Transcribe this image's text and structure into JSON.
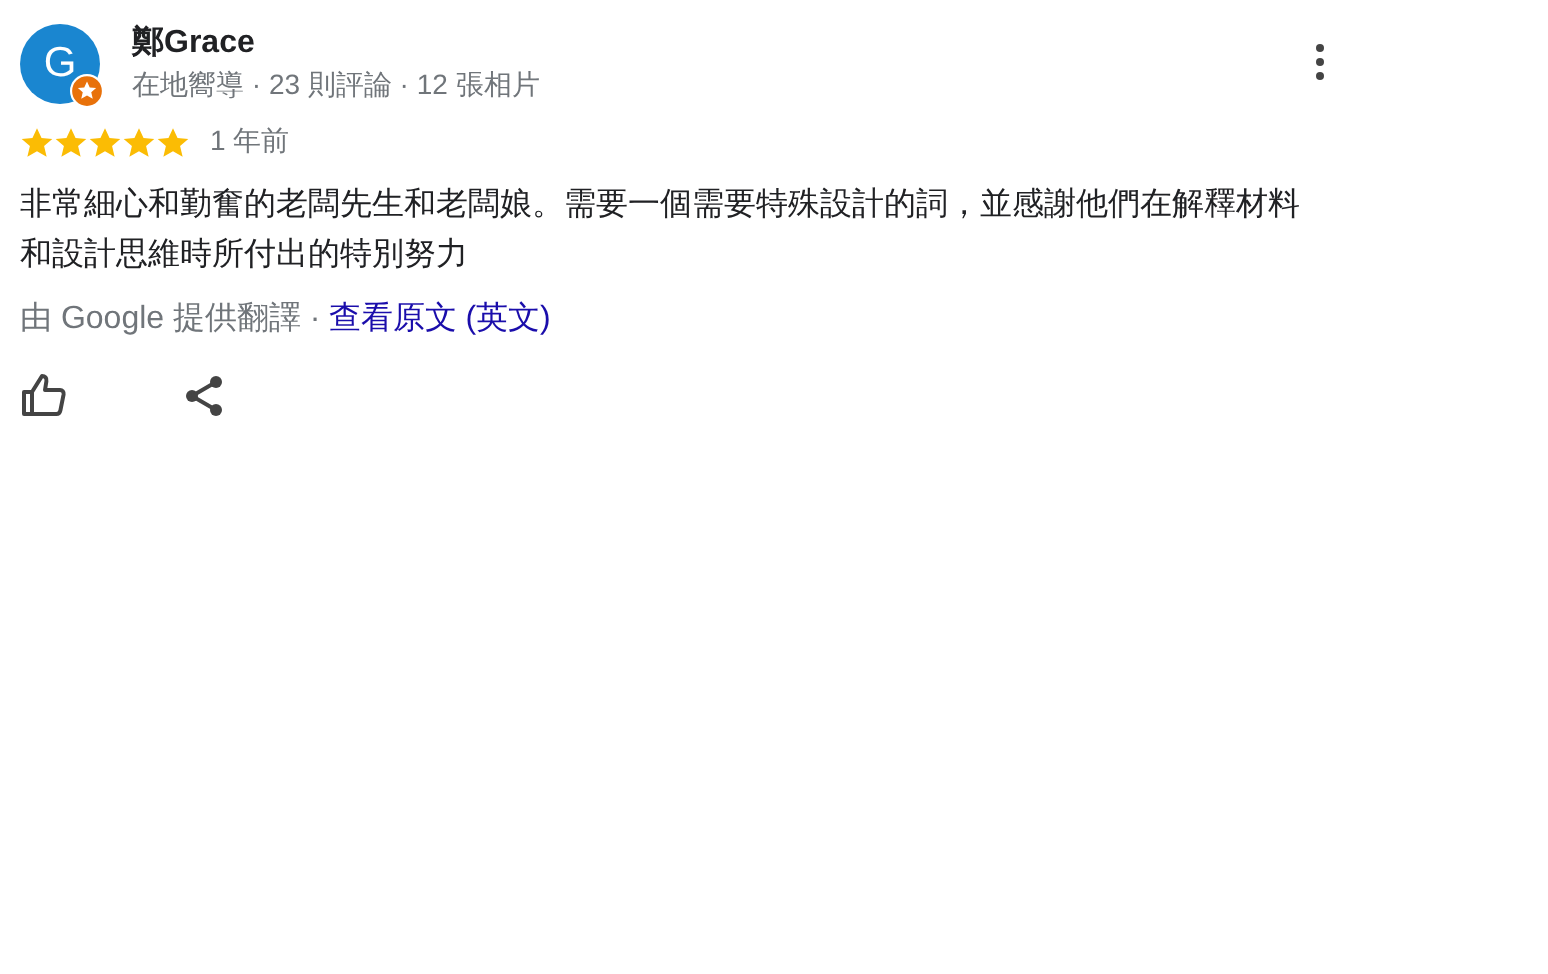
{
  "review": {
    "avatar_letter": "G",
    "local_guide": true,
    "author": "鄭Grace",
    "author_meta": "在地嚮導 · 23 則評論 · 12 張相片",
    "stars": 5,
    "time": "1 年前",
    "text": "非常細心和勤奮的老闆先生和老闆娘。需要一個需要特殊設計的詞，並感謝他們在解釋材料和設計思維時所付出的特別努力",
    "translation_note": "由 Google 提供翻譯 ·",
    "original_link": "查看原文 (英文)"
  }
}
